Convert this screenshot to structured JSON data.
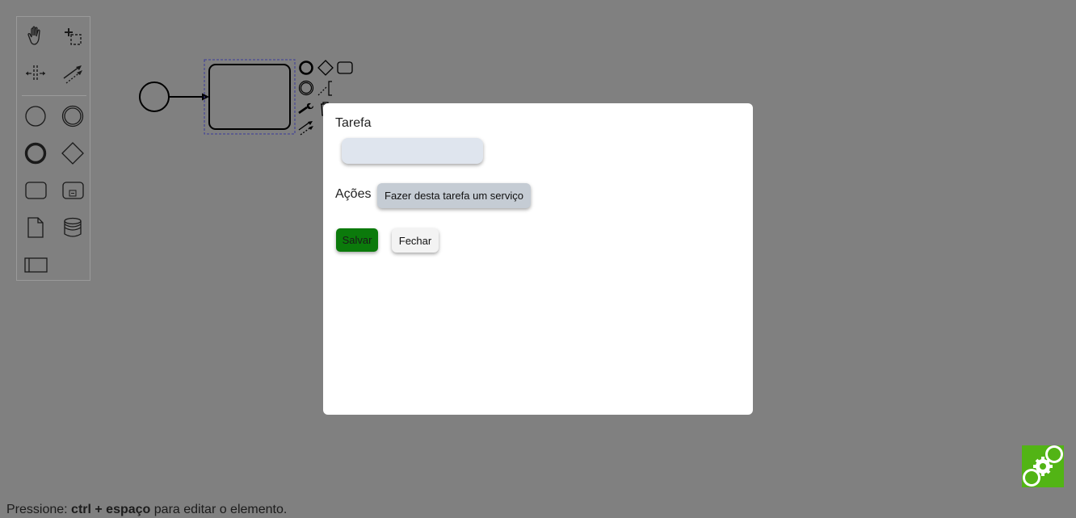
{
  "palette": {
    "tools": [
      {
        "icon": "hand-tool-icon"
      },
      {
        "icon": "lasso-tool-icon"
      },
      {
        "icon": "space-tool-icon"
      },
      {
        "icon": "global-connect-tool-icon"
      },
      {
        "icon": "start-event-icon"
      },
      {
        "icon": "intermediate-event-icon"
      },
      {
        "icon": "end-event-icon"
      },
      {
        "icon": "gateway-icon"
      },
      {
        "icon": "task-icon"
      },
      {
        "icon": "subprocess-icon"
      },
      {
        "icon": "data-object-icon"
      },
      {
        "icon": "data-store-icon"
      },
      {
        "icon": "participant-pool-icon"
      }
    ]
  },
  "modal": {
    "task_label": "Tarefa",
    "task_value": "",
    "actions_label": "Ações",
    "service_button": "Fazer desta tarefa um serviço",
    "save_button": "Salvar",
    "close_button": "Fechar"
  },
  "footer": {
    "prefix": "Pressione: ",
    "shortcut": "ctrl + espaço",
    "suffix": " para editar o elemento."
  },
  "colors": {
    "backdrop": "#808080",
    "save": "#0b7a0b",
    "logo": "#52b415"
  }
}
